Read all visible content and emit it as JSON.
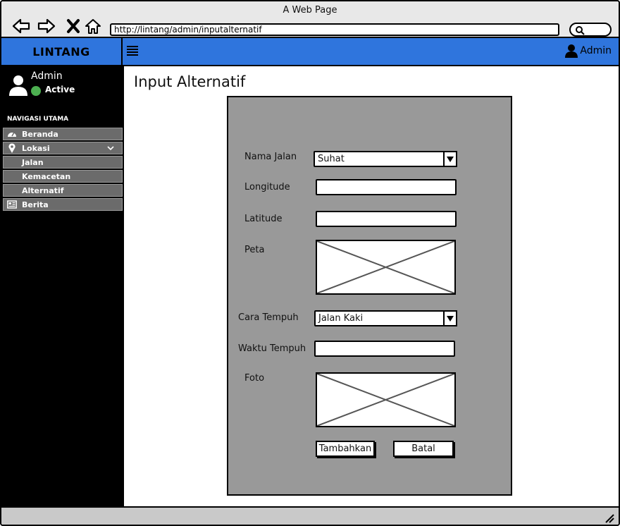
{
  "browser": {
    "window_title": "A Web Page",
    "url": "http://lintang/admin/inputalternatif"
  },
  "header": {
    "brand": "LINTANG",
    "user_label": "Admin"
  },
  "sidebar": {
    "user_name": "Admin",
    "status": "Active",
    "nav_heading": "NAVIGASI UTAMA",
    "items": [
      {
        "label": "Beranda",
        "icon": "dashboard-icon"
      },
      {
        "label": "Lokasi",
        "icon": "map-pin-icon"
      },
      {
        "label": "Jalan"
      },
      {
        "label": "Kemacetan"
      },
      {
        "label": "Alternatif"
      },
      {
        "label": "Berita",
        "icon": "newspaper-icon"
      }
    ]
  },
  "main": {
    "page_title": "Input Alternatif",
    "form": {
      "nama_jalan_label": "Nama Jalan",
      "nama_jalan_value": "Suhat",
      "longitude_label": "Longitude",
      "longitude_value": "",
      "latitude_label": "Latitude",
      "latitude_value": "",
      "peta_label": "Peta",
      "cara_tempuh_label": "Cara Tempuh",
      "cara_tempuh_value": "Jalan Kaki",
      "waktu_tempuh_label": "Waktu Tempuh",
      "waktu_tempuh_value": "",
      "foto_label": "Foto",
      "submit_label": "Tambahkan",
      "cancel_label": "Batal"
    }
  },
  "colors": {
    "header_blue": "#2f75dd",
    "panel_gray": "#999999",
    "sidebar_bg": "#000000",
    "nav_item_bg": "#6b6b6b",
    "status_green": "#4caf50"
  }
}
